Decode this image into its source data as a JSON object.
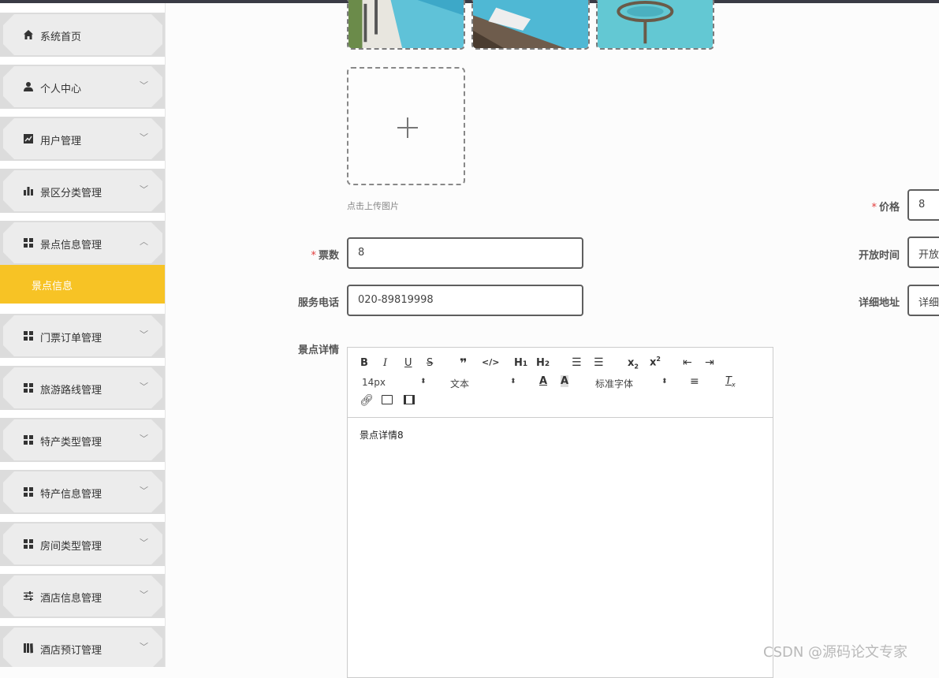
{
  "sidebar": {
    "items": [
      {
        "label": "系统首页",
        "icon": "home-icon"
      },
      {
        "label": "个人中心",
        "icon": "user-icon"
      },
      {
        "label": "用户管理",
        "icon": "chart-line-icon"
      },
      {
        "label": "景区分类管理",
        "icon": "bar-chart-icon"
      },
      {
        "label": "景点信息管理",
        "icon": "grid-icon"
      },
      {
        "label": "门票订单管理",
        "icon": "grid-icon"
      },
      {
        "label": "旅游路线管理",
        "icon": "grid-icon"
      },
      {
        "label": "特产类型管理",
        "icon": "grid-icon"
      },
      {
        "label": "特产信息管理",
        "icon": "grid-icon"
      },
      {
        "label": "房间类型管理",
        "icon": "grid-icon"
      },
      {
        "label": "酒店信息管理",
        "icon": "sliders-icon"
      },
      {
        "label": "酒店预订管理",
        "icon": "book-icon"
      }
    ],
    "active_sub": "景点信息",
    "expanded_item": "景点信息管理"
  },
  "form": {
    "upload_tip": "点击上传图片",
    "price_label": "价格",
    "price_value": "8",
    "tickets_label": "票数",
    "tickets_value": "8",
    "open_time_label": "开放时间",
    "open_time_value": "开放",
    "phone_label": "服务电话",
    "phone_value": "020-89819998",
    "address_label": "详细地址",
    "address_value": "详细",
    "detail_label": "景点详情"
  },
  "editor": {
    "font_size": "14px",
    "format": "文本",
    "font_family": "标准字体",
    "content": "景点详情8"
  },
  "watermark": "CSDN @源码论文专家",
  "colors": {
    "accent": "#f7c325",
    "required": "#e23c3c",
    "sidebar_bg": "#ececec"
  }
}
